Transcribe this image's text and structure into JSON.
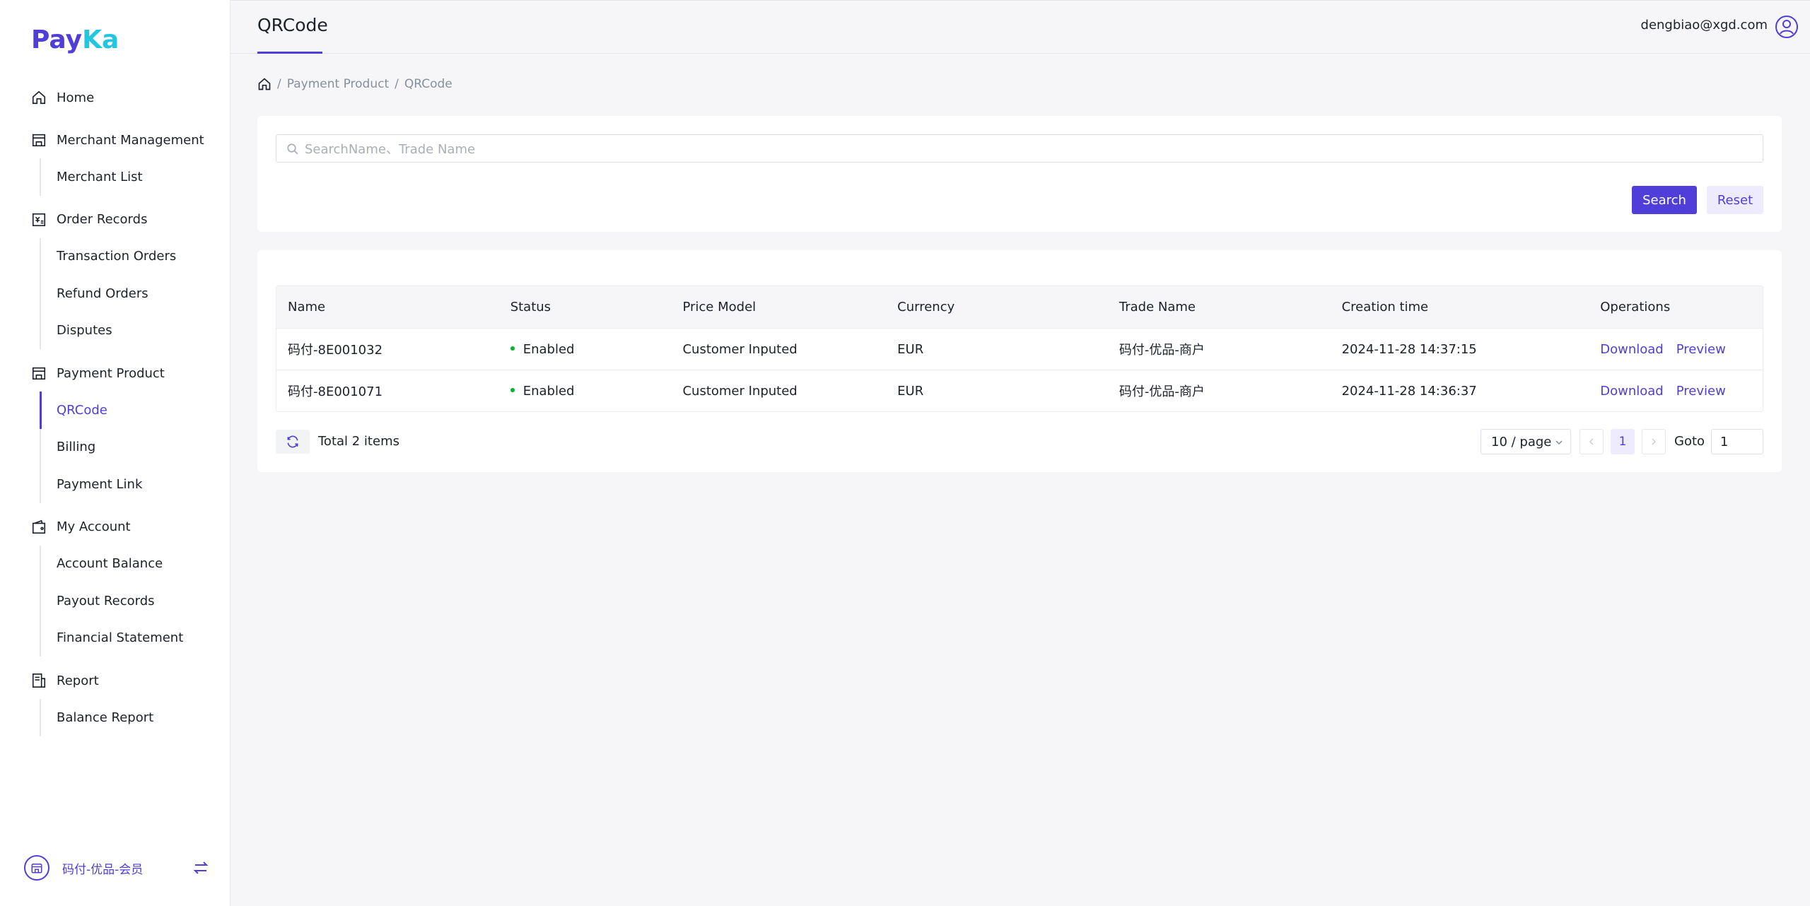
{
  "brand": {
    "name_pre": "Pay",
    "name_post": "Ka"
  },
  "header": {
    "tab_title": "QRCode",
    "user_email": "dengbiao@xgd.com"
  },
  "sidebar": {
    "groups": [
      {
        "label": "Home",
        "icon": "home-icon",
        "items": []
      },
      {
        "label": "Merchant Management",
        "icon": "store-icon",
        "items": [
          "Merchant List"
        ]
      },
      {
        "label": "Order Records",
        "icon": "order-icon",
        "items": [
          "Transaction Orders",
          "Refund Orders",
          "Disputes"
        ]
      },
      {
        "label": "Payment Product",
        "icon": "store-icon",
        "items": [
          "QRCode",
          "Billing",
          "Payment Link"
        ]
      },
      {
        "label": "My Account",
        "icon": "wallet-icon",
        "items": [
          "Account Balance",
          "Payout Records",
          "Financial Statement"
        ]
      },
      {
        "label": "Report",
        "icon": "report-icon",
        "items": [
          "Balance Report"
        ]
      }
    ],
    "active_item": "QRCode",
    "footer_store": "码付-优品-会员"
  },
  "breadcrumb": {
    "items": [
      "Payment Product",
      "QRCode"
    ],
    "separator": "/"
  },
  "search": {
    "placeholder": "SearchName、Trade Name",
    "search_label": "Search",
    "reset_label": "Reset"
  },
  "table": {
    "columns": [
      "Name",
      "Status",
      "Price Model",
      "Currency",
      "Trade Name",
      "Creation time",
      "Operations"
    ],
    "rows": [
      {
        "name": "码付-8E001032",
        "status": "Enabled",
        "price_model": "Customer Inputed",
        "currency": "EUR",
        "trade_name": "码付-优品-商户",
        "created": "2024-11-28 14:37:15",
        "op1": "Download",
        "op2": "Preview"
      },
      {
        "name": "码付-8E001071",
        "status": "Enabled",
        "price_model": "Customer Inputed",
        "currency": "EUR",
        "trade_name": "码付-优品-商户",
        "created": "2024-11-28 14:36:37",
        "op1": "Download",
        "op2": "Preview"
      }
    ]
  },
  "pagination": {
    "total_text": "Total 2 items",
    "page_size": "10 / page",
    "current_page": "1",
    "goto_label": "Goto",
    "goto_value": "1"
  },
  "colors": {
    "accent": "#4f3fd8",
    "status_enabled": "#00b42a",
    "brand_secondary": "#23c6e0"
  }
}
